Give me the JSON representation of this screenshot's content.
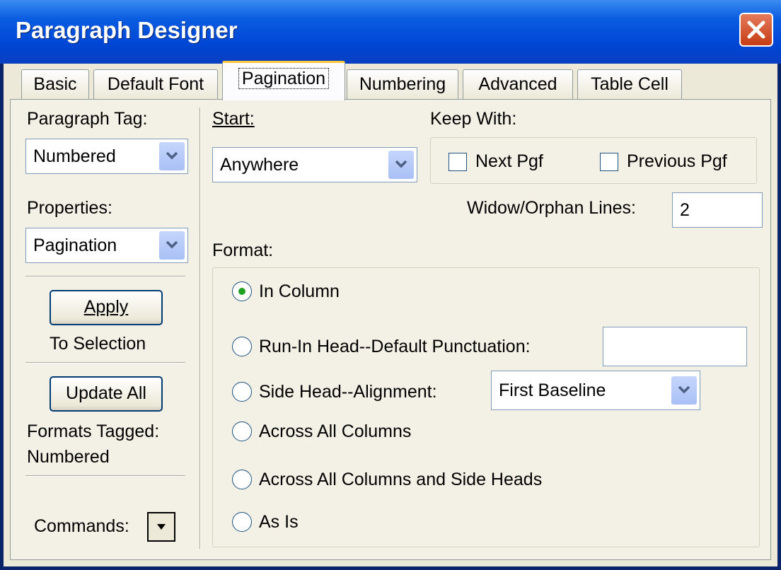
{
  "window": {
    "title": "Paragraph Designer"
  },
  "tabs": [
    "Basic",
    "Default Font",
    "Pagination",
    "Numbering",
    "Advanced",
    "Table Cell"
  ],
  "active_tab": "Pagination",
  "left": {
    "paragraph_tag_label": "Paragraph Tag:",
    "paragraph_tag_value": "Numbered",
    "properties_label": "Properties:",
    "properties_value": "Pagination",
    "apply_label": "Apply",
    "to_selection": "To Selection",
    "update_all_label": "Update All",
    "formats_tagged": "Formats Tagged:",
    "formats_tagged_value": "Numbered",
    "commands_label": "Commands:"
  },
  "start": {
    "label": "Start:",
    "value": "Anywhere"
  },
  "keep_with": {
    "label": "Keep With:",
    "next_pgf": "Next Pgf",
    "previous_pgf": "Previous Pgf"
  },
  "widow_orphan": {
    "label": "Widow/Orphan Lines:",
    "value": "2"
  },
  "format": {
    "label": "Format:",
    "in_column": "In Column",
    "run_in": "Run-In Head--Default Punctuation:",
    "run_in_value": "",
    "side_head": "Side Head--Alignment:",
    "side_head_value": "First Baseline",
    "across_all": "Across All Columns",
    "across_all_side": "Across All Columns and Side Heads",
    "as_is": "As Is"
  }
}
